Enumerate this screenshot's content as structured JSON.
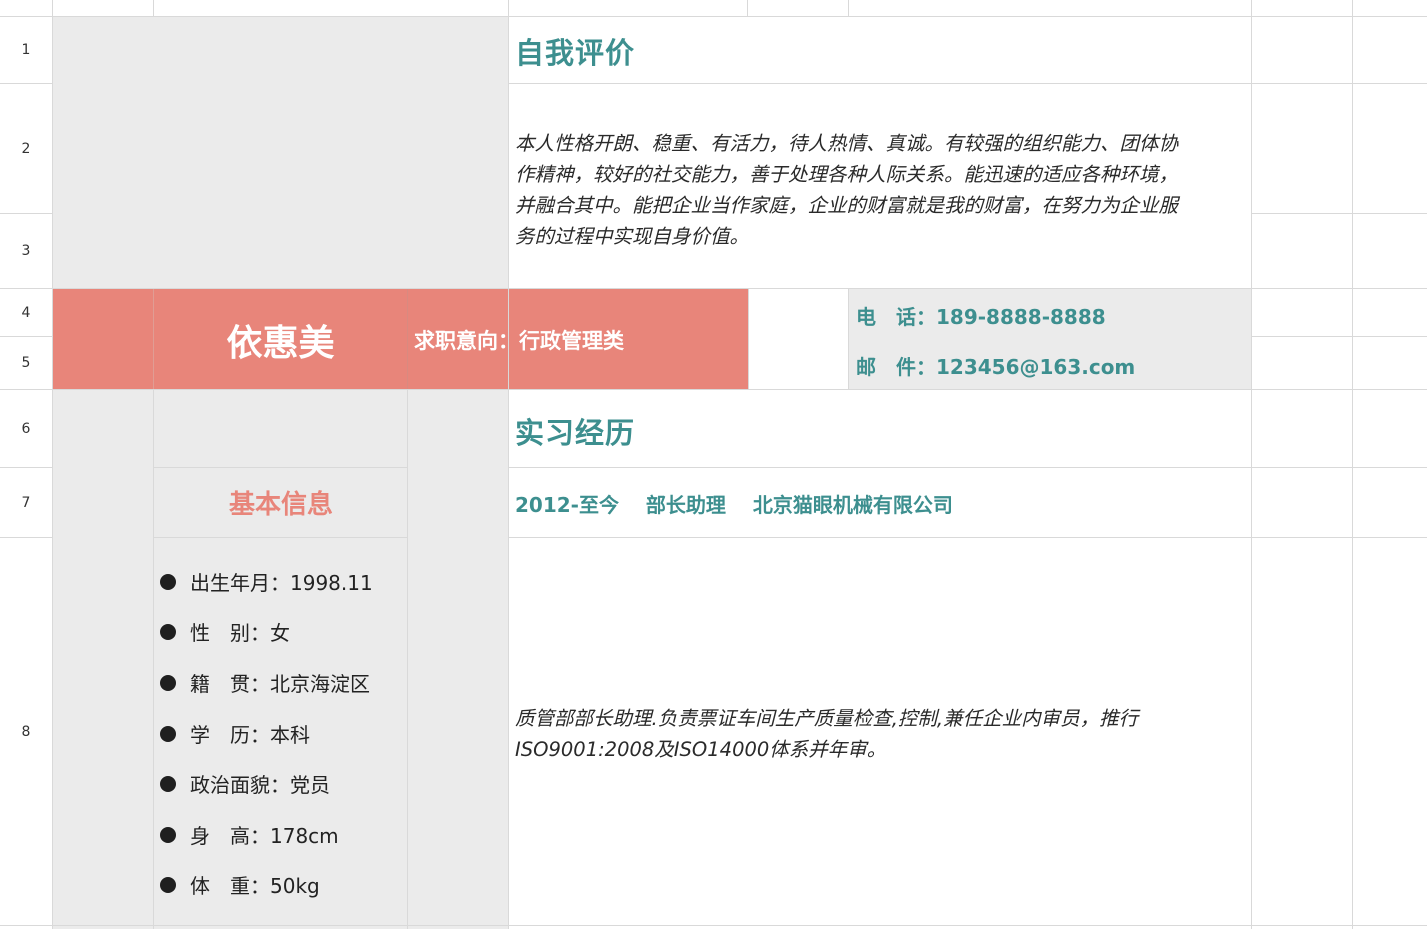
{
  "row_numbers": [
    "1",
    "2",
    "3",
    "4",
    "5",
    "6",
    "7",
    "8"
  ],
  "self_eval": {
    "title": "自我评价",
    "body_lines": [
      "本人性格开朗、稳重、有活力，待人热情、真诚。有较强的组织能力、团体协",
      "作精神，较好的社交能力，善于处理各种人际关系。能迅速的适应各种环境，",
      "并融合其中。能把企业当作家庭，企业的财富就是我的财富，在努力为企业服",
      "务的过程中实现自身价值。"
    ]
  },
  "header": {
    "name": "依惠美",
    "intent": "求职意向：行政管理类",
    "phone": "电　话：189-8888-8888",
    "email": "邮　件：123456@163.com"
  },
  "internship": {
    "title": "实习经历",
    "entry": "2012-至今　 部长助理　 北京猫眼机械有限公司",
    "desc_lines": [
      "质管部部长助理.负责票证车间生产质量检查,控制,兼任企业内审员，推行",
      "ISO9001:2008及ISO14000体系并年审。"
    ]
  },
  "basic_info": {
    "title": "基本信息",
    "items": [
      "出生年月：1998.11",
      "性　别：女",
      "籍　贯：北京海淀区",
      "学　历：本科",
      "政治面貌：党员",
      "身　高：178cm",
      "体　重：50kg"
    ]
  },
  "colors": {
    "teal": "#3d8f8f",
    "coral": "#e8857a",
    "gray_fill": "#ebebeb"
  }
}
